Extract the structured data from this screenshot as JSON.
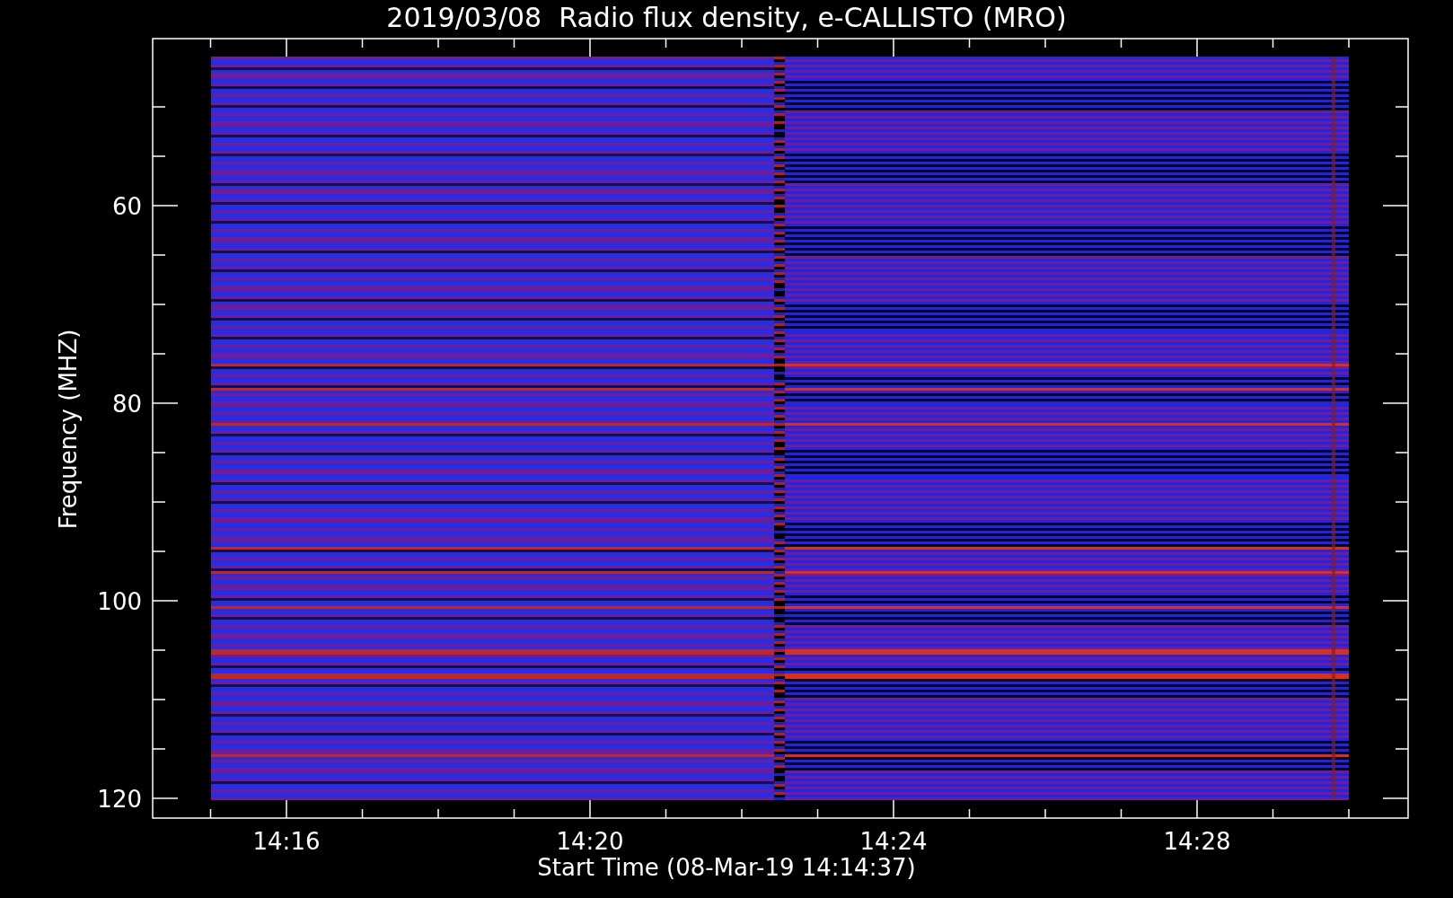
{
  "title": "2019/03/08  Radio flux density, e-CALLISTO (MRO)",
  "y_axis": {
    "label": "Frequency (MHZ)",
    "tick_labels": [
      "60",
      "80",
      "100",
      "120"
    ]
  },
  "x_axis": {
    "label": "Start Time (08-Mar-19 14:14:37)",
    "tick_labels": [
      "14:16",
      "14:20",
      "14:24",
      "14:28"
    ]
  }
}
